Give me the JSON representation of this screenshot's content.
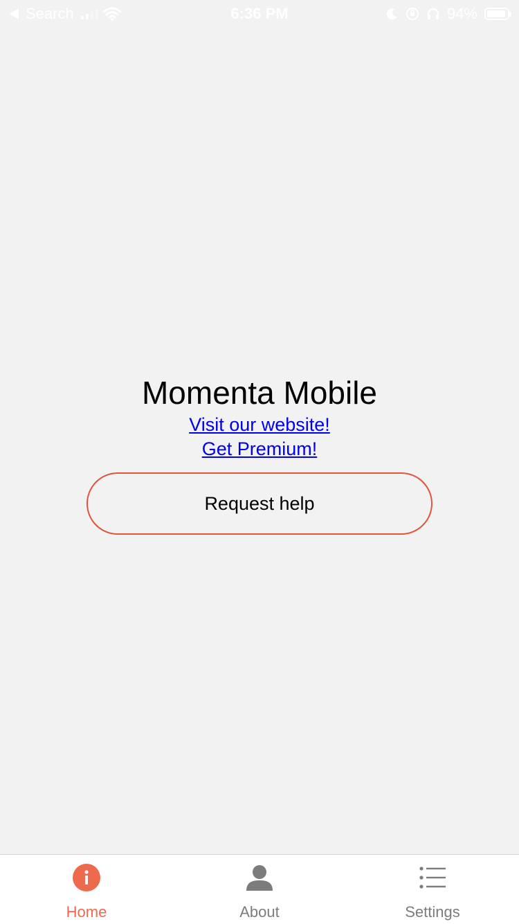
{
  "status_bar": {
    "back_label": "Search",
    "time": "6:36 PM",
    "battery_percent": "94%",
    "battery_level": 0.94
  },
  "main": {
    "title": "Momenta Mobile",
    "website_link": "Visit our website!",
    "premium_link": "Get Premium!",
    "help_button": "Request help"
  },
  "tabs": [
    {
      "label": "Home",
      "icon": "info-circle-icon",
      "active": true
    },
    {
      "label": "About",
      "icon": "person-icon",
      "active": false
    },
    {
      "label": "Settings",
      "icon": "list-icon",
      "active": false
    }
  ],
  "colors": {
    "accent": "#ee6a4d",
    "button_border": "#e0533d",
    "link": "#0000ee",
    "background": "#f2f2f2",
    "inactive_tab": "#7c7c7c"
  }
}
